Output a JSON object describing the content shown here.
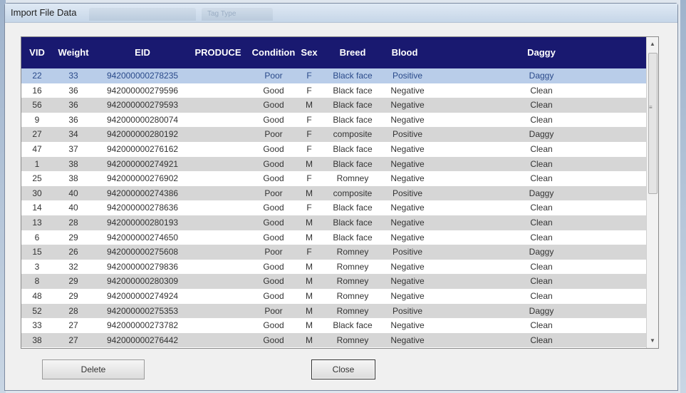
{
  "window": {
    "title": "Import File Data",
    "title_tabs": [
      "",
      "Tag Type"
    ]
  },
  "grid": {
    "columns": [
      "VID",
      "Weight",
      "EID",
      "PRODUCE",
      "Condition",
      "Sex",
      "Breed",
      "Blood",
      "Daggy"
    ],
    "rows": [
      [
        "22",
        "33",
        "942000000278235",
        "",
        "Poor",
        "F",
        "Black face",
        "Positive",
        "Daggy"
      ],
      [
        "16",
        "36",
        "942000000279596",
        "",
        "Good",
        "F",
        "Black face",
        "Negative",
        "Clean"
      ],
      [
        "56",
        "36",
        "942000000279593",
        "",
        "Good",
        "M",
        "Black face",
        "Negative",
        "Clean"
      ],
      [
        "9",
        "36",
        "942000000280074",
        "",
        "Good",
        "F",
        "Black face",
        "Negative",
        "Clean"
      ],
      [
        "27",
        "34",
        "942000000280192",
        "",
        "Poor",
        "F",
        "composite",
        "Positive",
        "Daggy"
      ],
      [
        "47",
        "37",
        "942000000276162",
        "",
        "Good",
        "F",
        "Black face",
        "Negative",
        "Clean"
      ],
      [
        "1",
        "38",
        "942000000274921",
        "",
        "Good",
        "M",
        "Black face",
        "Negative",
        "Clean"
      ],
      [
        "25",
        "38",
        "942000000276902",
        "",
        "Good",
        "F",
        "Romney",
        "Negative",
        "Clean"
      ],
      [
        "30",
        "40",
        "942000000274386",
        "",
        "Poor",
        "M",
        "composite",
        "Positive",
        "Daggy"
      ],
      [
        "14",
        "40",
        "942000000278636",
        "",
        "Good",
        "F",
        "Black face",
        "Negative",
        "Clean"
      ],
      [
        "13",
        "28",
        "942000000280193",
        "",
        "Good",
        "M",
        "Black face",
        "Negative",
        "Clean"
      ],
      [
        "6",
        "29",
        "942000000274650",
        "",
        "Good",
        "M",
        "Black face",
        "Negative",
        "Clean"
      ],
      [
        "15",
        "26",
        "942000000275608",
        "",
        "Poor",
        "F",
        "Romney",
        "Positive",
        "Daggy"
      ],
      [
        "3",
        "32",
        "942000000279836",
        "",
        "Good",
        "M",
        "Romney",
        "Negative",
        "Clean"
      ],
      [
        "8",
        "29",
        "942000000280309",
        "",
        "Good",
        "M",
        "Romney",
        "Negative",
        "Clean"
      ],
      [
        "48",
        "29",
        "942000000274924",
        "",
        "Good",
        "M",
        "Romney",
        "Negative",
        "Clean"
      ],
      [
        "52",
        "28",
        "942000000275353",
        "",
        "Poor",
        "M",
        "Romney",
        "Positive",
        "Daggy"
      ],
      [
        "33",
        "27",
        "942000000273782",
        "",
        "Good",
        "M",
        "Black face",
        "Negative",
        "Clean"
      ],
      [
        "38",
        "27",
        "942000000276442",
        "",
        "Good",
        "M",
        "Romney",
        "Negative",
        "Clean"
      ]
    ],
    "selected_row": 0
  },
  "buttons": {
    "delete": "Delete",
    "close": "Close"
  },
  "colors": {
    "header_bg": "#191970",
    "selected_row": "#b9cde9",
    "alt_row": "#d6d6d6"
  }
}
